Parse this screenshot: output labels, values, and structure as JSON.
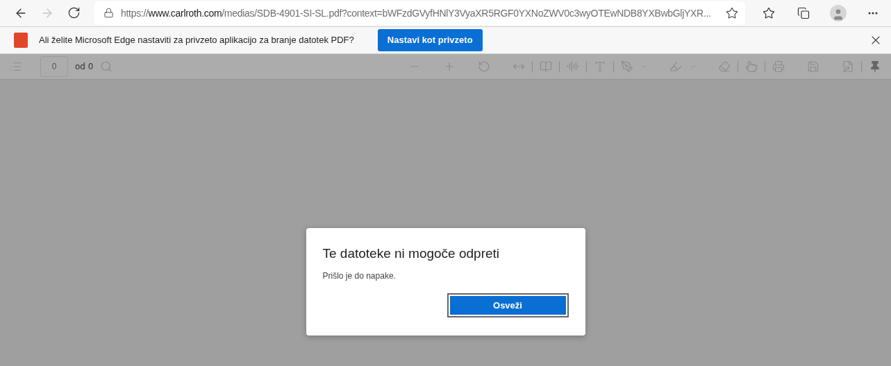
{
  "browser": {
    "address": "https://**www.carlroth.com**/medias/SDB-4901-SI-SL.pdf?context=bWFzdGVyfHNlY3VyaXR5RGF0YXNoZWV0c3wyOTEwNDB8YXBwbGljYXR...",
    "back_disabled": false,
    "forward_disabled": true
  },
  "infobar": {
    "message": "Ali želite Microsoft Edge nastaviti za privzeto aplikacijo za branje datotek PDF?",
    "button": "Nastavi kot privzeto"
  },
  "pdf_toolbar": {
    "page_field": "0",
    "page_count": "od 0",
    "disabled": true
  },
  "dialog": {
    "title": "Te datoteke ni mogoče odpreti",
    "message": "Prišlo je do napake.",
    "button": "Osveži"
  }
}
